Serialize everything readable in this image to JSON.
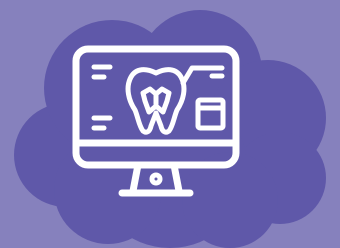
{
  "colors": {
    "background": "#8681bd",
    "cloud": "#5f58a9",
    "icon_stroke": "#ffffff"
  },
  "icons": {
    "cloud": "cloud-shape",
    "monitor": "monitor-icon",
    "tooth": "tooth-xray-icon"
  }
}
